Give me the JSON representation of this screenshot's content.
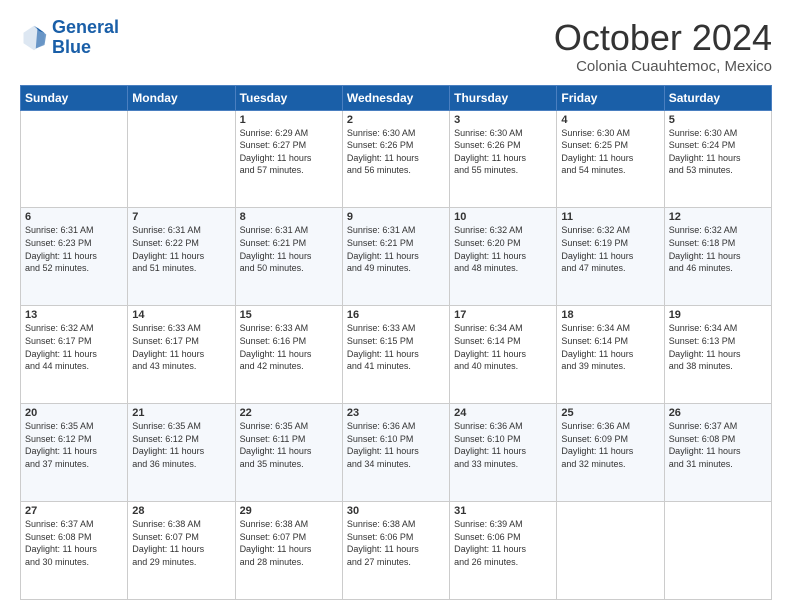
{
  "header": {
    "logo_line1": "General",
    "logo_line2": "Blue",
    "title": "October 2024",
    "subtitle": "Colonia Cuauhtemoc, Mexico"
  },
  "calendar": {
    "headers": [
      "Sunday",
      "Monday",
      "Tuesday",
      "Wednesday",
      "Thursday",
      "Friday",
      "Saturday"
    ],
    "weeks": [
      [
        {
          "day": "",
          "info": ""
        },
        {
          "day": "",
          "info": ""
        },
        {
          "day": "1",
          "info": "Sunrise: 6:29 AM\nSunset: 6:27 PM\nDaylight: 11 hours\nand 57 minutes."
        },
        {
          "day": "2",
          "info": "Sunrise: 6:30 AM\nSunset: 6:26 PM\nDaylight: 11 hours\nand 56 minutes."
        },
        {
          "day": "3",
          "info": "Sunrise: 6:30 AM\nSunset: 6:26 PM\nDaylight: 11 hours\nand 55 minutes."
        },
        {
          "day": "4",
          "info": "Sunrise: 6:30 AM\nSunset: 6:25 PM\nDaylight: 11 hours\nand 54 minutes."
        },
        {
          "day": "5",
          "info": "Sunrise: 6:30 AM\nSunset: 6:24 PM\nDaylight: 11 hours\nand 53 minutes."
        }
      ],
      [
        {
          "day": "6",
          "info": "Sunrise: 6:31 AM\nSunset: 6:23 PM\nDaylight: 11 hours\nand 52 minutes."
        },
        {
          "day": "7",
          "info": "Sunrise: 6:31 AM\nSunset: 6:22 PM\nDaylight: 11 hours\nand 51 minutes."
        },
        {
          "day": "8",
          "info": "Sunrise: 6:31 AM\nSunset: 6:21 PM\nDaylight: 11 hours\nand 50 minutes."
        },
        {
          "day": "9",
          "info": "Sunrise: 6:31 AM\nSunset: 6:21 PM\nDaylight: 11 hours\nand 49 minutes."
        },
        {
          "day": "10",
          "info": "Sunrise: 6:32 AM\nSunset: 6:20 PM\nDaylight: 11 hours\nand 48 minutes."
        },
        {
          "day": "11",
          "info": "Sunrise: 6:32 AM\nSunset: 6:19 PM\nDaylight: 11 hours\nand 47 minutes."
        },
        {
          "day": "12",
          "info": "Sunrise: 6:32 AM\nSunset: 6:18 PM\nDaylight: 11 hours\nand 46 minutes."
        }
      ],
      [
        {
          "day": "13",
          "info": "Sunrise: 6:32 AM\nSunset: 6:17 PM\nDaylight: 11 hours\nand 44 minutes."
        },
        {
          "day": "14",
          "info": "Sunrise: 6:33 AM\nSunset: 6:17 PM\nDaylight: 11 hours\nand 43 minutes."
        },
        {
          "day": "15",
          "info": "Sunrise: 6:33 AM\nSunset: 6:16 PM\nDaylight: 11 hours\nand 42 minutes."
        },
        {
          "day": "16",
          "info": "Sunrise: 6:33 AM\nSunset: 6:15 PM\nDaylight: 11 hours\nand 41 minutes."
        },
        {
          "day": "17",
          "info": "Sunrise: 6:34 AM\nSunset: 6:14 PM\nDaylight: 11 hours\nand 40 minutes."
        },
        {
          "day": "18",
          "info": "Sunrise: 6:34 AM\nSunset: 6:14 PM\nDaylight: 11 hours\nand 39 minutes."
        },
        {
          "day": "19",
          "info": "Sunrise: 6:34 AM\nSunset: 6:13 PM\nDaylight: 11 hours\nand 38 minutes."
        }
      ],
      [
        {
          "day": "20",
          "info": "Sunrise: 6:35 AM\nSunset: 6:12 PM\nDaylight: 11 hours\nand 37 minutes."
        },
        {
          "day": "21",
          "info": "Sunrise: 6:35 AM\nSunset: 6:12 PM\nDaylight: 11 hours\nand 36 minutes."
        },
        {
          "day": "22",
          "info": "Sunrise: 6:35 AM\nSunset: 6:11 PM\nDaylight: 11 hours\nand 35 minutes."
        },
        {
          "day": "23",
          "info": "Sunrise: 6:36 AM\nSunset: 6:10 PM\nDaylight: 11 hours\nand 34 minutes."
        },
        {
          "day": "24",
          "info": "Sunrise: 6:36 AM\nSunset: 6:10 PM\nDaylight: 11 hours\nand 33 minutes."
        },
        {
          "day": "25",
          "info": "Sunrise: 6:36 AM\nSunset: 6:09 PM\nDaylight: 11 hours\nand 32 minutes."
        },
        {
          "day": "26",
          "info": "Sunrise: 6:37 AM\nSunset: 6:08 PM\nDaylight: 11 hours\nand 31 minutes."
        }
      ],
      [
        {
          "day": "27",
          "info": "Sunrise: 6:37 AM\nSunset: 6:08 PM\nDaylight: 11 hours\nand 30 minutes."
        },
        {
          "day": "28",
          "info": "Sunrise: 6:38 AM\nSunset: 6:07 PM\nDaylight: 11 hours\nand 29 minutes."
        },
        {
          "day": "29",
          "info": "Sunrise: 6:38 AM\nSunset: 6:07 PM\nDaylight: 11 hours\nand 28 minutes."
        },
        {
          "day": "30",
          "info": "Sunrise: 6:38 AM\nSunset: 6:06 PM\nDaylight: 11 hours\nand 27 minutes."
        },
        {
          "day": "31",
          "info": "Sunrise: 6:39 AM\nSunset: 6:06 PM\nDaylight: 11 hours\nand 26 minutes."
        },
        {
          "day": "",
          "info": ""
        },
        {
          "day": "",
          "info": ""
        }
      ]
    ]
  }
}
